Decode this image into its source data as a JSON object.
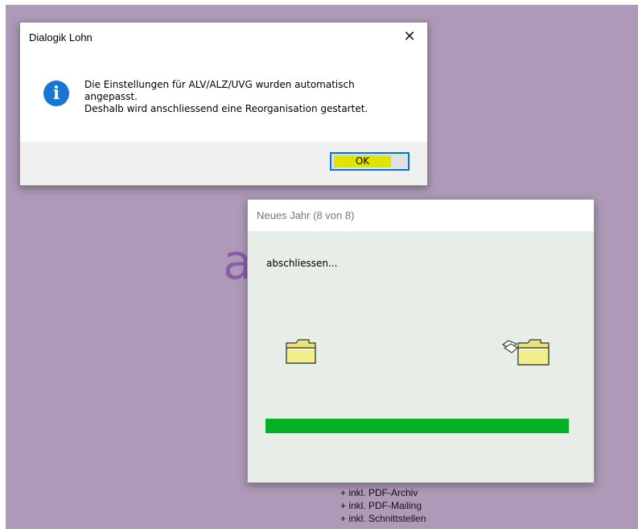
{
  "background": {
    "logo_fragment": "a",
    "features": [
      "+ inkl. PDF-Archiv",
      "+ inkl. PDF-Mailing",
      "+ inkl. Schnittstellen"
    ]
  },
  "message_box": {
    "title": "Dialogik Lohn",
    "close_symbol": "✕",
    "icon": "info-icon",
    "lines": [
      "Die Einstellungen für ALV/ALZ/UVG wurden automatisch",
      "angepasst.",
      "Deshalb wird anschliessend eine Reorganisation gestartet."
    ],
    "ok_label": "OK"
  },
  "progress_window": {
    "title": "Neues Jahr (8 von 8)",
    "status": "abschliessen...",
    "progress_fraction": 1.0
  },
  "colors": {
    "desktop": "#ae9ab8",
    "accent": "#0078d7",
    "progress": "#06b025",
    "ok_highlight": "#e1e400"
  }
}
